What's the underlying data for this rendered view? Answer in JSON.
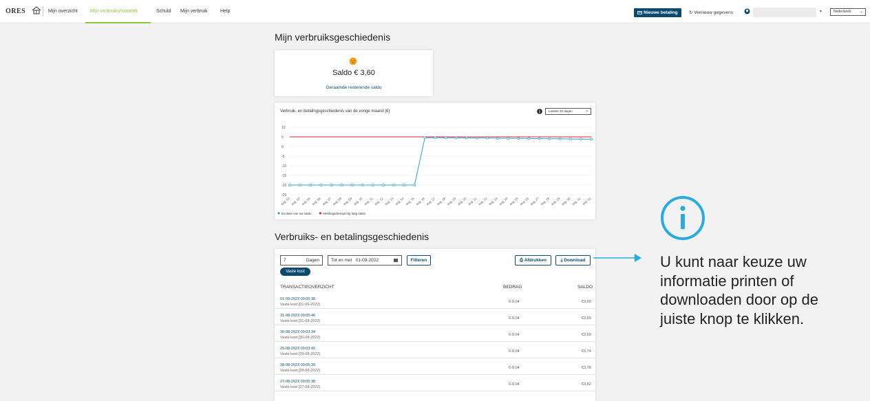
{
  "nav": {
    "logo": "ORES",
    "items": [
      "Mijn overzicht",
      "Mijn verbruikshistoriek",
      "Schuld",
      "Mijn verbruik",
      "Help"
    ],
    "pay_button": "Nieuwe betaling",
    "refresh": "Vernieuw gegevens",
    "language": "Nederlands"
  },
  "page_title": "Mijn verbruiksgeschiedenis",
  "saldo": {
    "label": "Saldo € 3,60",
    "link": "Geraamde resterende saldo"
  },
  "chart_data": {
    "type": "line",
    "title": "Verbruik- en betalingsgeschiedenis van de vorige maand [€]",
    "period_select": "Laatste 30 dagen",
    "x": [
      "aug. 03",
      "aug. 04",
      "aug. 05",
      "aug. 06",
      "aug. 07",
      "aug. 08",
      "aug. 09",
      "aug. 10",
      "aug. 11",
      "aug. 12",
      "aug. 13",
      "aug. 14",
      "aug. 15",
      "aug. 16",
      "aug. 17",
      "aug. 18",
      "aug. 19",
      "aug. 20",
      "aug. 21",
      "aug. 22",
      "aug. 23",
      "aug. 24",
      "aug. 25",
      "aug. 26",
      "aug. 27",
      "aug. 28",
      "aug. 29",
      "aug. 30",
      "aug. 31",
      "sep. 01"
    ],
    "y_ticks": [
      "10",
      "5",
      "0",
      "-5",
      "-10",
      "-15",
      "-20",
      "-25"
    ],
    "ylim": [
      -25,
      10
    ],
    "series": [
      {
        "name": "Evolutie van uw saldo",
        "color": "#2b9fd4",
        "values": [
          -20,
          -20,
          -20,
          -20,
          -20,
          -20,
          -20,
          -20,
          -20,
          -20,
          -20,
          -20,
          -20,
          4.6,
          4.6,
          4.6,
          4.5,
          4.5,
          4.4,
          4.4,
          4.3,
          4.3,
          4.2,
          4.2,
          4.1,
          4.0,
          4.0,
          3.9,
          3.9,
          3.8
        ]
      },
      {
        "name": "Meldingsdrempel bij laag saldo",
        "color": "#d9262e",
        "values": [
          5,
          5,
          5,
          5,
          5,
          5,
          5,
          5,
          5,
          5,
          5,
          5,
          5,
          5,
          5,
          5,
          5,
          5,
          5,
          5,
          5,
          5,
          5,
          5,
          5,
          5,
          5,
          5,
          5,
          5
        ]
      }
    ],
    "grid": true,
    "legend": "bottom-left"
  },
  "tx_title": "Verbruiks- en betalingsgeschiedenis",
  "filters": {
    "days_value": "7",
    "days_label": "Dagen",
    "date_label": "Tot en met",
    "date_value": "01-09-2022",
    "filter_button": "Filteren",
    "print_button": "Afdrukken",
    "download_button": "Download",
    "tag": "Vaste kost"
  },
  "table": {
    "headers": [
      "TRANSACTIEOVERZICHT",
      "BEDRAG",
      "SALDO"
    ],
    "rows": [
      {
        "date": "01-09-2022 09:05:38",
        "desc": "Vaste kost [01-09-2022]",
        "amount": "€-0,04",
        "balance": "€3,60"
      },
      {
        "date": "31-08-2022 09:05:46",
        "desc": "Vaste kost [31-08-2022]",
        "amount": "€-0,04",
        "balance": "€3,65"
      },
      {
        "date": "30-08-2022 09:03:34",
        "desc": "Vaste kost [30-08-2022]",
        "amount": "€-0,04",
        "balance": "€3,69"
      },
      {
        "date": "29-08-2022 09:03:42",
        "desc": "Vaste kost [29-08-2022]",
        "amount": "€-0,04",
        "balance": "€3,74"
      },
      {
        "date": "28-08-2022 09:05:39",
        "desc": "Vaste kost [28-08-2022]",
        "amount": "€-0,04",
        "balance": "€3,78"
      },
      {
        "date": "27-08-2022 09:05:38",
        "desc": "Vaste kost [27-08-2022]",
        "amount": "€-0,04",
        "balance": "€3,82"
      }
    ]
  },
  "annotation": "U kunt naar keuze uw informatie printen of downloaden door op de juiste knop te klikken.",
  "colors": {
    "accent": "#0b4a6e",
    "active_nav": "#8dc63f",
    "info": "#29abe2"
  }
}
